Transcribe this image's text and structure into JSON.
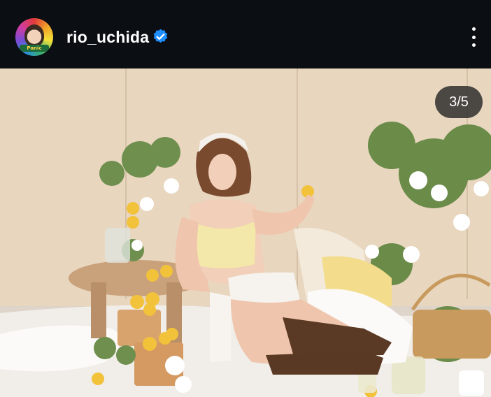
{
  "header": {
    "username": "rio_uchida",
    "avatar_tag": "Panic",
    "verified_icon": "verified-badge-icon",
    "more_icon": "more-vertical-icon",
    "verified_color": "#1f8fff"
  },
  "post": {
    "counter": "3/5",
    "image_alt": "photo"
  }
}
